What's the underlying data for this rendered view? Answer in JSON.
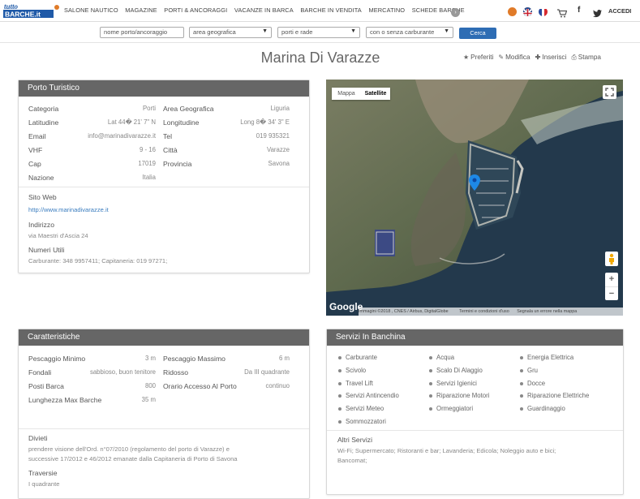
{
  "brand": {
    "logo_text_top": "tutto",
    "logo_text_bottom": "BARCHE.it"
  },
  "nav": {
    "items": [
      "SALONE NAUTICO",
      "MAGAZINE",
      "PORTI & ANCORAGGI",
      "VACANZE IN BARCA",
      "BARCHE IN VENDITA",
      "MERCATINO",
      "SCHEDE BARCHE"
    ],
    "more_label": "›",
    "login_label": "ACCEDI",
    "colors": {
      "flame": "#e07b29",
      "facebook": "#333333",
      "twitter": "#333333"
    }
  },
  "search": {
    "name_placeholder": "nome porto/ancoraggio",
    "area_label": "area geografica",
    "porti_label": "porti e rade",
    "carburante_label": "con o senza carburante",
    "button_label": "Cerca"
  },
  "page": {
    "title": "Marina Di Varazze",
    "actions": [
      {
        "icon": "star-icon",
        "label": "Preferiti"
      },
      {
        "icon": "pencil-icon",
        "label": "Modifica"
      },
      {
        "icon": "plus-icon",
        "label": "Inserisci"
      },
      {
        "icon": "print-icon",
        "label": "Stampa"
      }
    ]
  },
  "porto": {
    "header": "Porto Turistico",
    "left": [
      {
        "label": "Categoria",
        "value": "Porti"
      },
      {
        "label": "Latitudine",
        "value": "Lat 44� 21' 7\" N"
      },
      {
        "label": "Email",
        "value": "info@marinadivarazze.it"
      },
      {
        "label": "VHF",
        "value": "9 - 16"
      },
      {
        "label": "Cap",
        "value": "17019"
      },
      {
        "label": "Nazione",
        "value": "Italia"
      }
    ],
    "right": [
      {
        "label": "Area Geografica",
        "value": "Liguria"
      },
      {
        "label": "Longitudine",
        "value": "Long 8� 34' 3\" E"
      },
      {
        "label": "Tel",
        "value": "019 935321"
      },
      {
        "label": "Città",
        "value": "Varazze"
      },
      {
        "label": "Provincia",
        "value": "Savona"
      }
    ],
    "sito_label": "Sito Web",
    "sito_value": "http://www.marinadivarazze.it",
    "indirizzo_label": "Indirizzo",
    "indirizzo_value": "via Maestri d'Ascia 24",
    "numeri_label": "Numeri Utili",
    "numeri_value": "Carburante: 348 9957411; Capitaneria: 019 97271;"
  },
  "map": {
    "tab_map": "Mappa",
    "tab_sat": "Satellite",
    "google_label": "Google",
    "attribution": "Immagini ©2018 , CNES / Airbus, DigitalGlobe",
    "terms": "Termini e condizioni d'uso",
    "report": "Segnala un errore nella mappa",
    "zoom_in": "+",
    "zoom_out": "−"
  },
  "caratteristiche": {
    "header": "Caratteristiche",
    "left": [
      {
        "label": "Pescaggio Minimo",
        "value": "3 m"
      },
      {
        "label": "Fondali",
        "value": "sabbioso, buon tenitore"
      },
      {
        "label": "Posti Barca",
        "value": "800"
      },
      {
        "label": "Lunghezza Max Barche",
        "value": "35 m"
      }
    ],
    "right": [
      {
        "label": "Pescaggio Massimo",
        "value": "6 m"
      },
      {
        "label": "Ridosso",
        "value": "Da III quadrante"
      },
      {
        "label": "Orario Accesso Al Porto",
        "value": "continuo"
      }
    ],
    "divieti_label": "Divieti",
    "divieti_line1": "prendere visione dell'Ord. n°07/2010 (regolamento del porto di Varazze) e",
    "divieti_line2": "successive 17/2012 e 46/2012 emanate dalla Capitaneria di Porto di Savona",
    "traversie_label": "Traversie",
    "traversie_value": "I quadrante"
  },
  "servizi": {
    "header": "Servizi In Banchina",
    "col1": [
      "Carburante",
      "Scivolo",
      "Travel Lift",
      "Servizi Antincendio",
      "Servizi Meteo",
      "Sommozzatori"
    ],
    "col2": [
      "Acqua",
      "Scalo Di Alaggio",
      "Servizi Igienici",
      "Riparazione Motori",
      "Ormeggiatori"
    ],
    "col3": [
      "Energia Elettrica",
      "Gru",
      "Docce",
      "Riparazione Elettriche",
      "Guardinaggio"
    ],
    "altri_label": "Altri Servizi",
    "altri_line1": "Wi-Fi; Supermercato; Ristoranti e bar; Lavanderia; Edicola; Noleggio auto e bici;",
    "altri_line2": "Bancomat;"
  }
}
